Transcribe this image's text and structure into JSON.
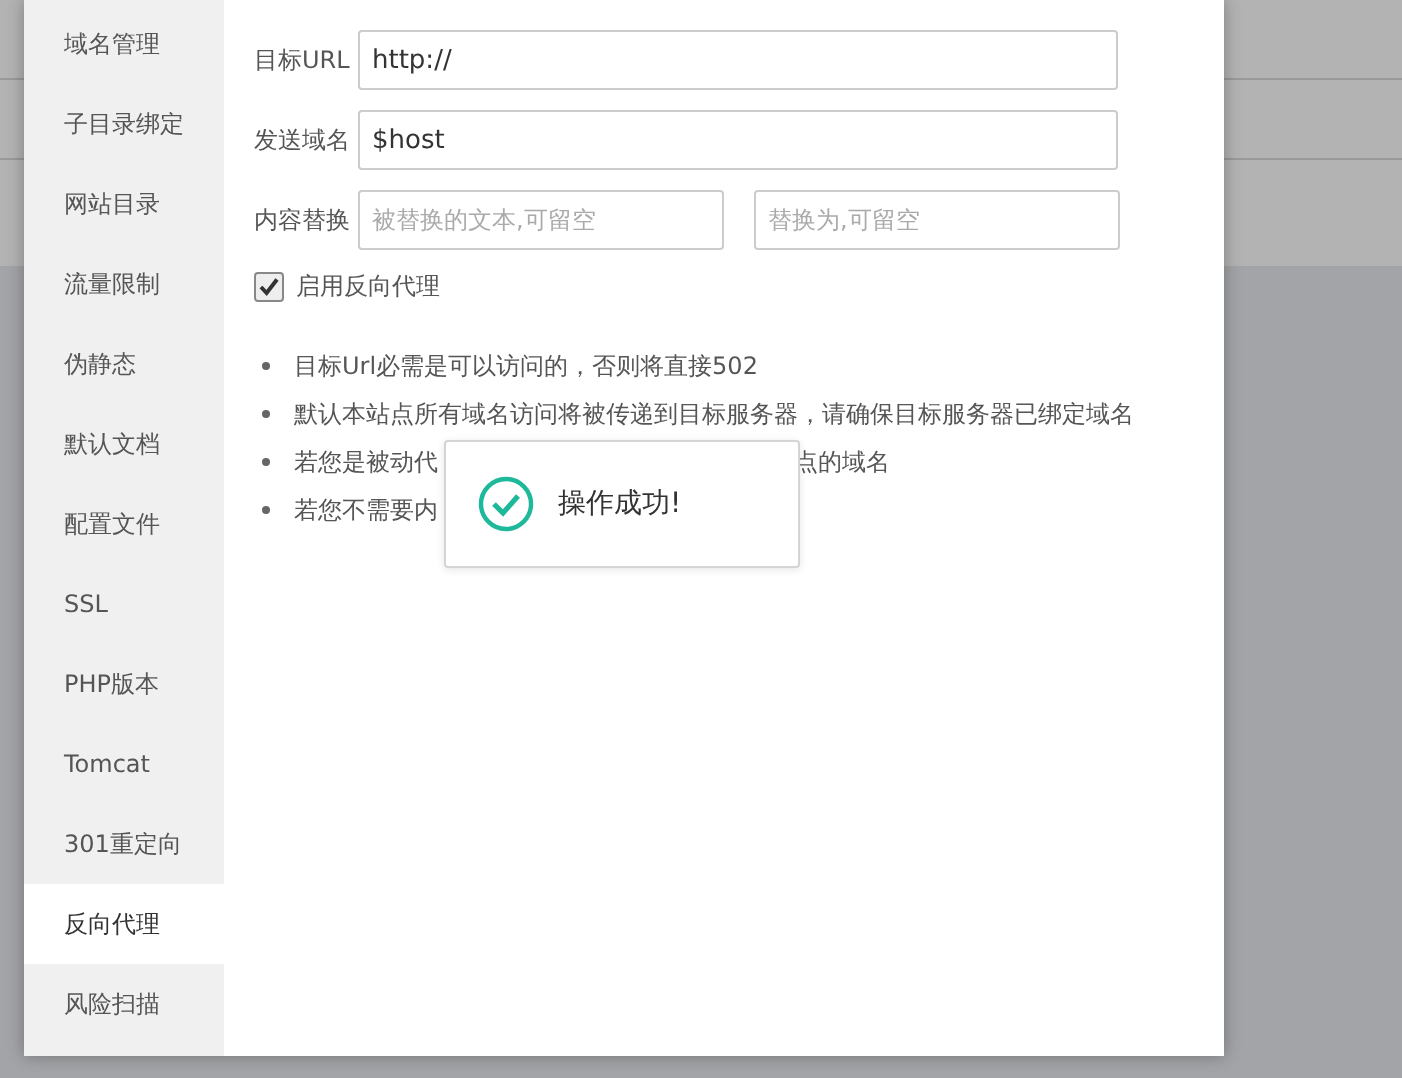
{
  "sidebar": {
    "items": [
      {
        "label": "域名管理",
        "selected": false
      },
      {
        "label": "子目录绑定",
        "selected": false
      },
      {
        "label": "网站目录",
        "selected": false
      },
      {
        "label": "流量限制",
        "selected": false
      },
      {
        "label": "伪静态",
        "selected": false
      },
      {
        "label": "默认文档",
        "selected": false
      },
      {
        "label": "配置文件",
        "selected": false
      },
      {
        "label": "SSL",
        "selected": false
      },
      {
        "label": "PHP版本",
        "selected": false
      },
      {
        "label": "Tomcat",
        "selected": false
      },
      {
        "label": "301重定向",
        "selected": false
      },
      {
        "label": "反向代理",
        "selected": true
      },
      {
        "label": "风险扫描",
        "selected": false
      }
    ]
  },
  "form": {
    "target_url": {
      "label": "目标URL",
      "value": "http://"
    },
    "send_domain": {
      "label": "发送域名",
      "value": "$host"
    },
    "content_replace": {
      "label": "内容替换",
      "from_placeholder": "被替换的文本,可留空",
      "to_placeholder": "替换为,可留空"
    },
    "enable_proxy": {
      "label": "启用反向代理",
      "checked": true
    }
  },
  "notes": [
    {
      "left": "目标Url必需是可以访问的，否则将直接502"
    },
    {
      "left": "默认本站点所有域名访问将被传递到目标服务器，请确保目标服务器已绑定域名"
    },
    {
      "left": "若您是被动代",
      "right": "点的域名"
    },
    {
      "left": "若您不需要内"
    }
  ],
  "toast": {
    "message": "操作成功!"
  }
}
